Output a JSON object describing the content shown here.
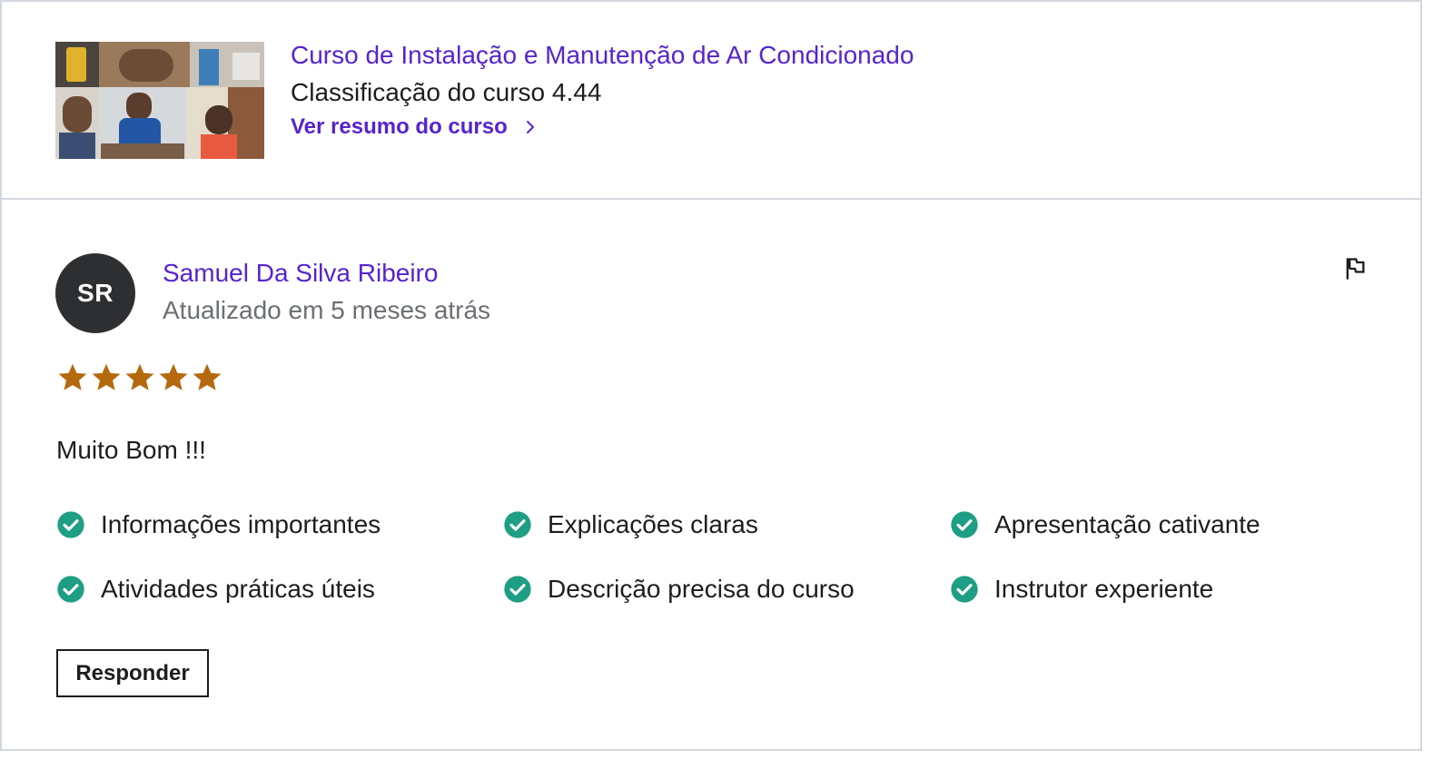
{
  "course": {
    "title": "Curso de Instalação e Manutenção de Ar Condicionado",
    "rating_text": "Classificação do curso 4.44",
    "summary_link": "Ver resumo do curso"
  },
  "review": {
    "avatar_initials": "SR",
    "reviewer_name": "Samuel Da Silva Ribeiro",
    "updated": "Atualizado em 5 meses atrás",
    "rating": 5,
    "text": "Muito Bom !!!",
    "tags": [
      "Informações importantes",
      "Explicações claras",
      "Apresentação cativante",
      "Atividades práticas úteis",
      "Descrição precisa do curso",
      "Instrutor experiente"
    ],
    "reply_label": "Responder"
  },
  "colors": {
    "link": "#5624d0",
    "star": "#b4690e",
    "check": "#1e9e84",
    "avatar_bg": "#2d2f31"
  },
  "icons": {
    "chevron": "chevron-right-icon",
    "flag": "flag-icon",
    "star": "star-icon",
    "check": "check-circle-icon"
  }
}
